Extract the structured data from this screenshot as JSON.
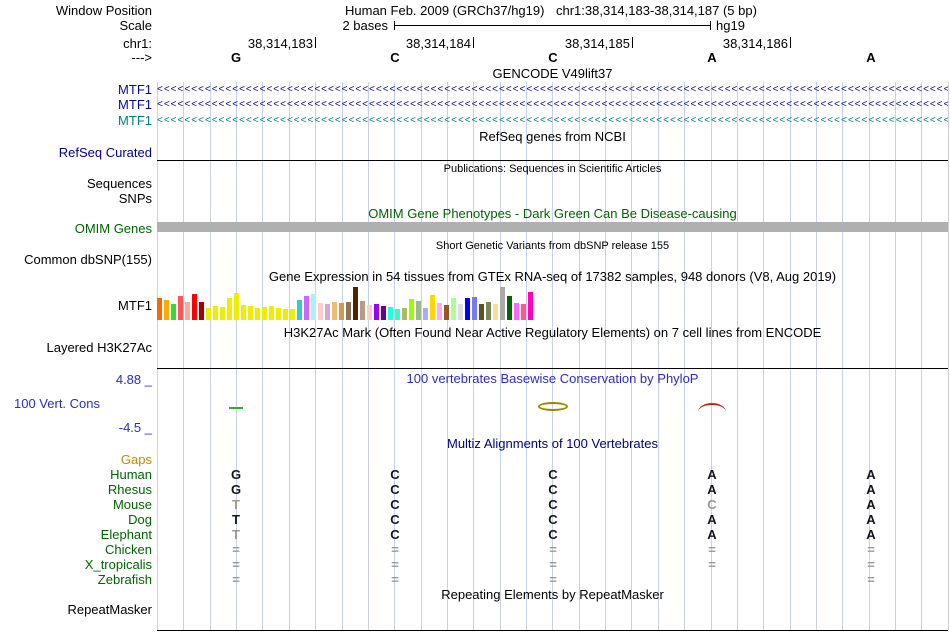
{
  "meta": {
    "window_position_label": "Window Position",
    "assembly_line": "Human Feb. 2009 (GRCh37/hg19)",
    "position_line": "chr1:38,314,183-38,314,187 (5 bp)",
    "scale_label": "Scale",
    "scale_text": "2 bases",
    "assembly_tag": "hg19",
    "chrom_label": "chr1:",
    "direction_label": "--->",
    "coords": [
      "38,314,183",
      "38,314,184",
      "38,314,185",
      "38,314,186"
    ],
    "bases": [
      "G",
      "C",
      "C",
      "A",
      "A"
    ]
  },
  "tracks": {
    "gencode": {
      "header": "GENCODE V49lift37",
      "arrow_char": "<",
      "genes": [
        {
          "label": "MTF1",
          "color": "#0C0C8A"
        },
        {
          "label": "MTF1",
          "color": "#0C0C8A"
        },
        {
          "label": "MTF1",
          "color": "#008080"
        }
      ]
    },
    "refseq": {
      "header": "RefSeq genes from NCBI",
      "label": "RefSeq Curated"
    },
    "publications": {
      "header": "Publications: Sequences in Scientific Articles",
      "sequences_label": "Sequences",
      "snps_label": "SNPs"
    },
    "omim": {
      "header": "OMIM Gene Phenotypes - Dark Green Can Be Disease-causing",
      "label": "OMIM Genes"
    },
    "dbsnp": {
      "header": "Short Genetic Variants from dbSNP release 155",
      "label": "Common dbSNP(155)"
    },
    "gtex": {
      "header": "Gene Expression in 54 tissues from GTEx RNA-seq of 17382 samples, 948 donors (V8, Aug 2019)",
      "label": "MTF1"
    },
    "h3k27ac": {
      "header": "H3K27Ac Mark (Often Found Near Active Regulatory Elements) on 7 cell lines from ENCODE",
      "label": "Layered H3K27Ac"
    },
    "cons": {
      "header": "100 vertebrates Basewise Conservation by PhyloP",
      "label": "100 Vert. Cons",
      "max_label": "4.88 _",
      "min_label": "-4.5 _",
      "marks": [
        {
          "shape": "dash",
          "base": 1,
          "color": "#33AA33"
        },
        {
          "shape": "ellipse",
          "base": 3,
          "color": "#9A8800"
        },
        {
          "shape": "arc",
          "base": 4,
          "color": "#CC2222"
        }
      ]
    },
    "multiz": {
      "header": "Multiz Alignments of 100 Vertebrates",
      "gaps_label": "Gaps",
      "rows": [
        {
          "species": "Human",
          "cells": [
            "G",
            "C",
            "C",
            "A",
            "A"
          ],
          "dim": [
            0,
            0,
            0,
            0,
            0
          ]
        },
        {
          "species": "Rhesus",
          "cells": [
            "G",
            "C",
            "C",
            "A",
            "A"
          ],
          "dim": [
            0,
            0,
            0,
            0,
            0
          ]
        },
        {
          "species": "Mouse",
          "cells": [
            "T",
            "C",
            "C",
            "C",
            "A"
          ],
          "dim": [
            1,
            0,
            0,
            1,
            0
          ]
        },
        {
          "species": "Dog",
          "cells": [
            "T",
            "C",
            "C",
            "A",
            "A"
          ],
          "dim": [
            0,
            0,
            0,
            0,
            0
          ]
        },
        {
          "species": "Elephant",
          "cells": [
            "T",
            "C",
            "C",
            "A",
            "A"
          ],
          "dim": [
            1,
            0,
            0,
            0,
            0
          ]
        },
        {
          "species": "Chicken",
          "cells": [
            "=",
            "=",
            "=",
            "=",
            "="
          ],
          "dim": [
            1,
            1,
            1,
            1,
            1
          ]
        },
        {
          "species": "X_tropicalis",
          "cells": [
            "=",
            "=",
            "=",
            "=",
            "="
          ],
          "dim": [
            1,
            1,
            1,
            1,
            1
          ]
        },
        {
          "species": "Zebrafish",
          "cells": [
            "=",
            "=",
            "=",
            "",
            "="
          ],
          "dim": [
            1,
            1,
            1,
            0,
            1
          ]
        }
      ]
    },
    "repeatmasker": {
      "header": "Repeating Elements by RepeatMasker",
      "label": "RepeatMasker"
    }
  },
  "colors": {
    "gridline": "#C9D1E8",
    "refseq_blue": "#00008B",
    "omim_green": "#006400",
    "omim_bar_gray": "#B0B0B0",
    "cons_blue": "#2B2BC8",
    "multiz_navy": "#000080",
    "species_green": "#006400",
    "gaps_orange": "#CC8800",
    "dim_gray": "#999999",
    "letter_dark": "#14141E"
  },
  "chart_data": {
    "type": "bar",
    "title": "Gene Expression in 54 tissues from GTEx RNA-seq of 17382 samples, 948 donors (V8, Aug 2019)",
    "series_label": "MTF1",
    "values": [
      22,
      20,
      16,
      24,
      18,
      26,
      18,
      12,
      14,
      13,
      22,
      27,
      15,
      14,
      12,
      13,
      14,
      12,
      11,
      11,
      20,
      24,
      26,
      17,
      16,
      18,
      17,
      18,
      33,
      19,
      15,
      16,
      14,
      13,
      11,
      12,
      21,
      19,
      12,
      25,
      17,
      15,
      22,
      16,
      22,
      23,
      16,
      18,
      16,
      33,
      24,
      17,
      16,
      28
    ],
    "colors": [
      "#FF6600",
      "#FFAA00",
      "#33DD33",
      "#FF5555",
      "#FFAA99",
      "#FF0000",
      "#AA0000",
      "#EEEE00",
      "#EEEE00",
      "#EEEE00",
      "#EEEE00",
      "#EEEE00",
      "#EEEE00",
      "#EEEE00",
      "#EEEE00",
      "#EEEE00",
      "#EEEE00",
      "#EEEE00",
      "#EEEE00",
      "#EEEE00",
      "#33CCCC",
      "#CC66FF",
      "#AAEEFF",
      "#FFCCCC",
      "#CCAADD",
      "#EEBB77",
      "#CC9955",
      "#8B7355",
      "#552200",
      "#BB9988",
      "#FFCCCC",
      "#9900FF",
      "#660099",
      "#22FFDD",
      "#33FFC2",
      "#AABB66",
      "#99FF00",
      "#99BB88",
      "#AAAAFF",
      "#FFD700",
      "#FFAAFF",
      "#995522",
      "#AAFF99",
      "#DDDDDD",
      "#0000FF",
      "#7777FF",
      "#555522",
      "#778855",
      "#FFDD99",
      "#AAAAAA",
      "#006600",
      "#FF66FF",
      "#FF5599",
      "#FF00BB"
    ]
  }
}
